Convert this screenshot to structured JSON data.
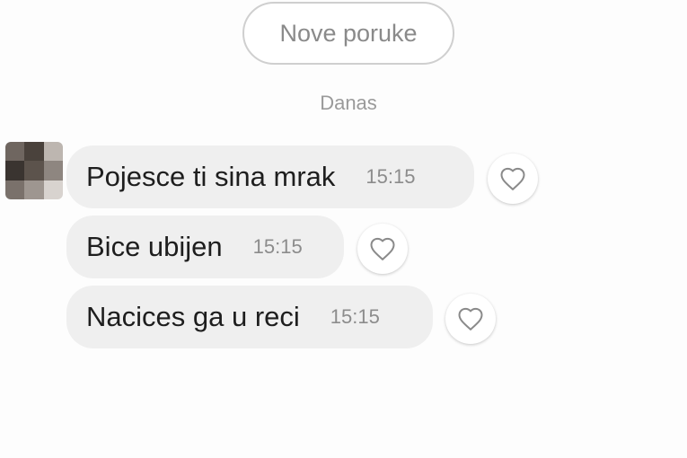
{
  "header": {
    "new_messages_label": "Nove poruke",
    "date_label": "Danas"
  },
  "messages": [
    {
      "text": "Pojesce ti sina mrak",
      "time": "15:15"
    },
    {
      "text": "Bice ubijen",
      "time": "15:15"
    },
    {
      "text": "Nacices ga u reci",
      "time": "15:15"
    }
  ],
  "icons": {
    "like": "heart-icon",
    "avatar": "blurred-avatar"
  },
  "colors": {
    "bubble_background": "#efefef",
    "text": "#1e1e1e",
    "timestamp": "#8c8c8c",
    "pill_border": "#cfcfcf"
  }
}
